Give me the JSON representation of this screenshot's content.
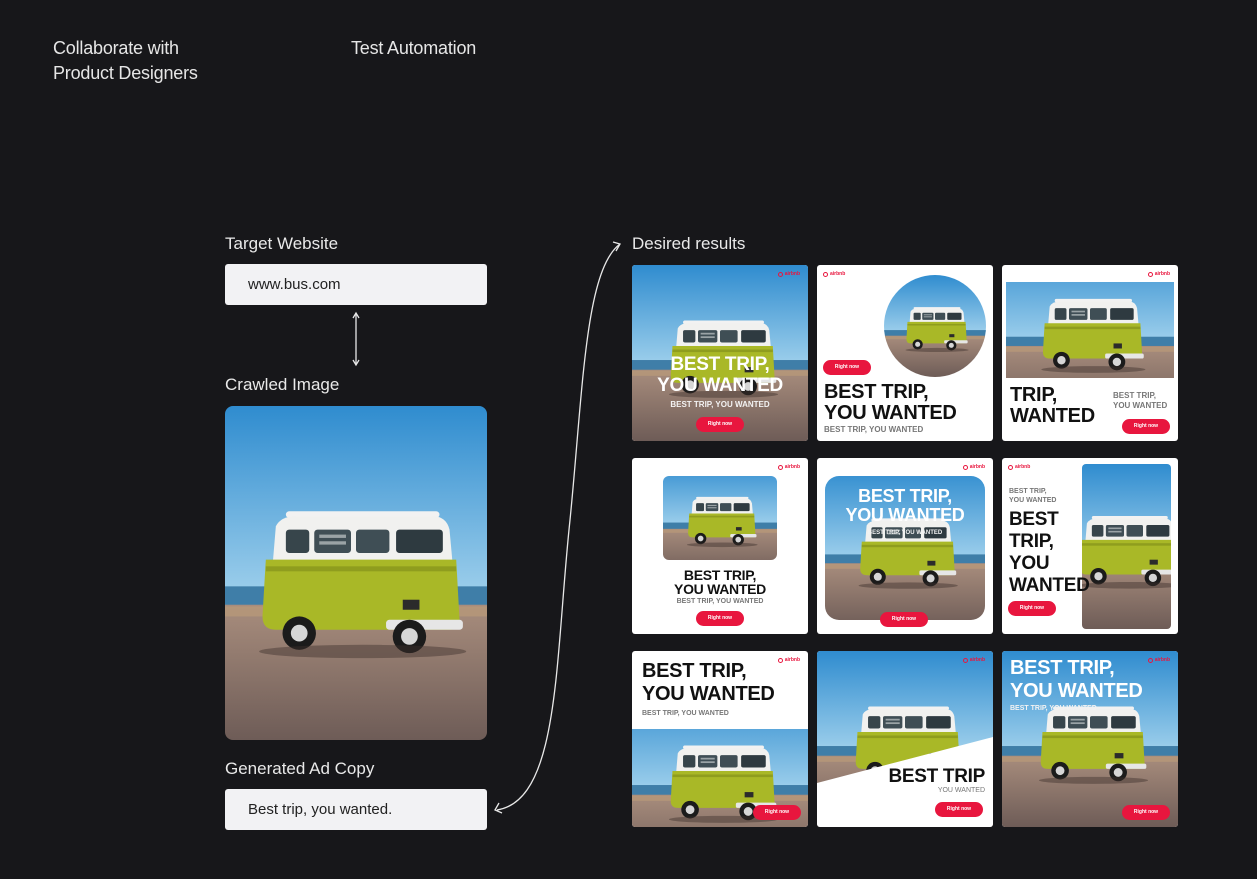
{
  "header": {
    "left_title": "Collaborate with Product Designers",
    "right_title": "Test Automation"
  },
  "pipeline": {
    "target_label": "Target Website",
    "target_value": "www.bus.com",
    "crawled_label": "Crawled Image",
    "adcopy_label": "Generated Ad Copy",
    "adcopy_value": "Best trip, you wanted."
  },
  "results": {
    "label": "Desired results",
    "headline": "BEST TRIP, YOU WANTED",
    "headline_l1": "BEST TRIP,",
    "headline_l2": "YOU WANTED",
    "sub": "BEST TRIP, YOU WANTED",
    "cta": "Right now",
    "brand": "airbnb",
    "card3_l1": "TRIP,",
    "card3_l2": "WANTED",
    "card3_sub_l1": "BEST TRIP,",
    "card3_sub_l2": "YOU WANTED",
    "card6_sub_l1": "BEST TRIP,",
    "card6_sub_l2": "YOU WANTED",
    "card6_w1": "BEST",
    "card6_w2": "TRIP,",
    "card6_w3": "YOU",
    "card6_w4": "WANTED",
    "card8_title": "BEST TRIP",
    "card8_sub": "YOU WANTED"
  },
  "colors": {
    "background": "#17171a",
    "cta_red": "#e8163e",
    "van_green": "#a9b827",
    "sky_blue": "#4c9fd6"
  }
}
